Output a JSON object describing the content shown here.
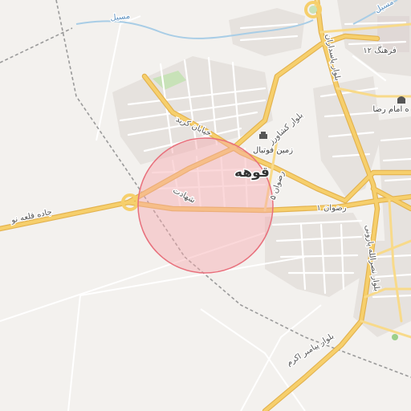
{
  "map": {
    "colors": {
      "background": "#f3f1ee",
      "road_major": "#f6cf6c",
      "road_major_casing": "#e3b24e",
      "road_minor": "#ffffff",
      "block": "#e4e0dc",
      "park": "#c8e2b8",
      "water": "#9fc8e3",
      "railway": "#9a9a9a",
      "circle_fill": "#f7a8ae",
      "circle_stroke": "#e8707c",
      "text": "#555555",
      "water_text": "#5a8fbf"
    },
    "labels": {
      "town": "قوهه",
      "stadium": "زمین فوتبال",
      "imam_reza": "ه امام رضا",
      "farhang": "فرهنگ ۱۲",
      "keshavarz": "بلوار کشاورز",
      "pasdaran": "بلوار پاسداران",
      "khayyam": "خیابان کرید",
      "shahadat": "شهادت",
      "rezvan_vertical": "رضوان ۵",
      "rezvan_1": "رضوان ۱",
      "nasrollah": "بلوار نصرالله پارونی",
      "payambar": "بلوار پیامبر اکرم",
      "ghale_no": "جاده قلعه نو",
      "masil_1": "مسیل",
      "masil_2": "مسیل"
    },
    "icons": {
      "stadium": "stadium-icon",
      "mosque": "mosque-icon",
      "park_marker": "park-icon"
    }
  }
}
